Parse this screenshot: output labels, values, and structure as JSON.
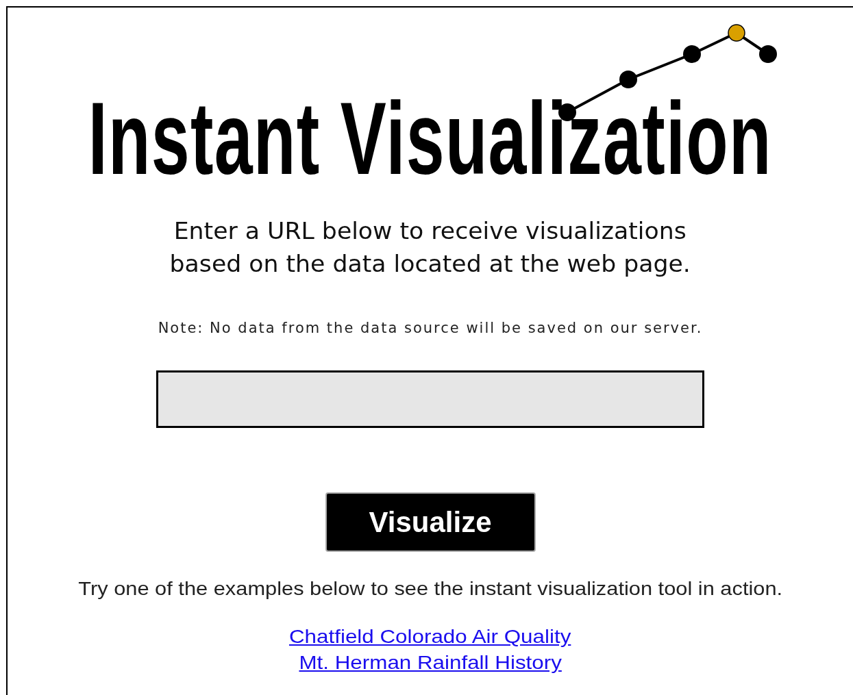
{
  "logo": {
    "title": "Instant Visualization"
  },
  "intro": [
    "Enter a URL below to receive visualizations",
    "based on the data located at the web page."
  ],
  "note": "Note: No data from the data source will be saved on our server.",
  "button": "Visualize",
  "examples_text": "Try one of the examples below to see the instant visualization tool in action.",
  "examples": [
    "Chatfield Colorado Air Quality",
    "Mt. Herman Rainfall History"
  ]
}
